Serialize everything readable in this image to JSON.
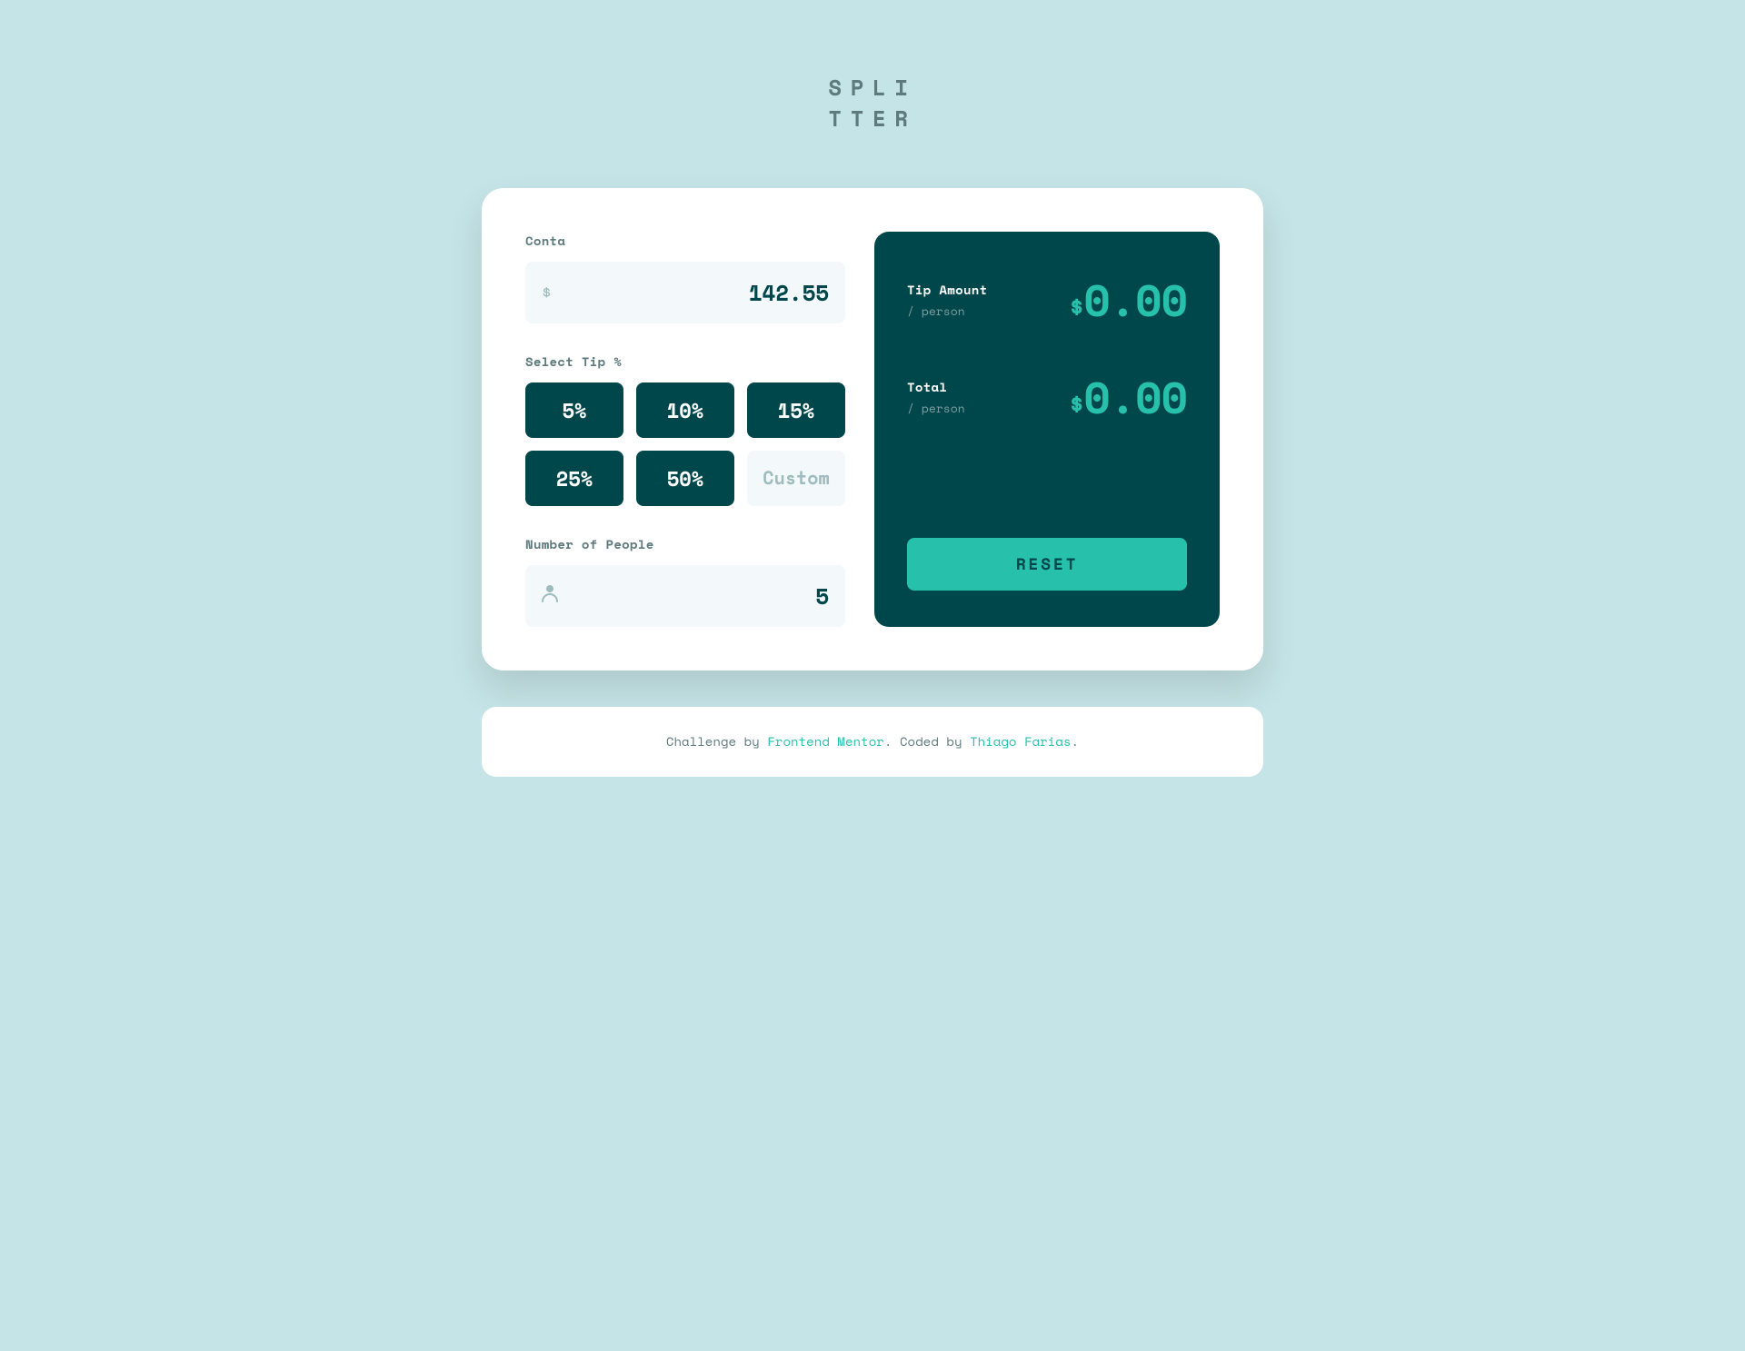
{
  "title": {
    "line1": "SPLI",
    "line2": "TTER"
  },
  "card": {
    "bill": {
      "label": "Conta",
      "placeholder": "",
      "value": "142.55",
      "icon": "$"
    },
    "tip": {
      "label": "Select Tip %",
      "buttons": [
        {
          "label": "5%",
          "value": 5
        },
        {
          "label": "10%",
          "value": 10
        },
        {
          "label": "15%",
          "value": 15
        },
        {
          "label": "25%",
          "value": 25
        },
        {
          "label": "50%",
          "value": 50
        },
        {
          "label": "Custom",
          "value": "custom"
        }
      ]
    },
    "people": {
      "label": "Number of People",
      "value": "5",
      "placeholder": ""
    }
  },
  "results": {
    "tip_amount": {
      "label": "Tip Amount",
      "sublabel": "/ person",
      "value": "$0.00"
    },
    "total": {
      "label": "Total",
      "sublabel": "/ person",
      "value": "$0.00"
    },
    "reset_label": "RESET"
  },
  "footer": {
    "challenge_text": "Challenge by ",
    "challenge_link_text": "Frontend Mentor",
    "challenge_link_url": "#",
    "coded_text": ". Coded by ",
    "coded_link_text": "Thiago Farias",
    "coded_link_url": "#",
    "period": "."
  }
}
